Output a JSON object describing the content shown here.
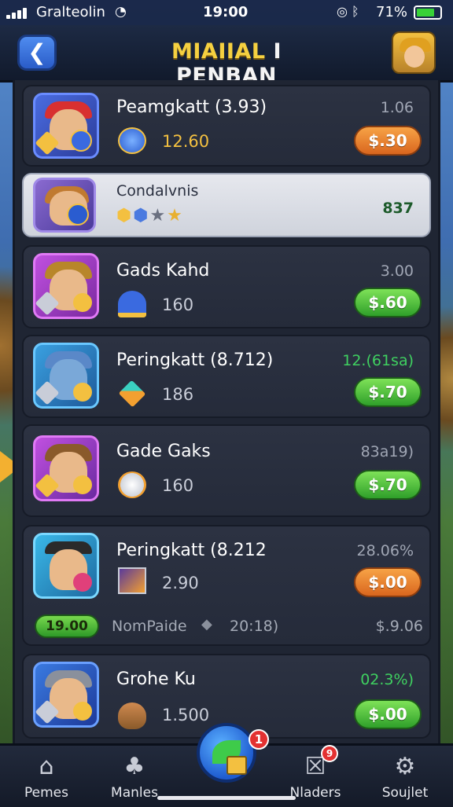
{
  "status_bar": {
    "carrier": "Gralteolin",
    "time": "19:00",
    "battery_pct": "71%",
    "icons": [
      "signal-icon",
      "wifi-icon",
      "alarm-icon",
      "bluetooth-icon",
      "battery-icon"
    ]
  },
  "header": {
    "title_left": "MIAIIAL",
    "title_right": "I PENBAN",
    "back_icon": "back-arrow-icon",
    "avatar_icon": "player-avatar-icon"
  },
  "rows": [
    {
      "name": "Peamgkatt (3.93)",
      "stat": "1.06",
      "count": "12.60",
      "price": "$.30",
      "price_color": "orange"
    },
    {
      "name": "Condalvnis",
      "stat": "837",
      "selected": true
    },
    {
      "name": "Gads Kahd",
      "stat": "3.00",
      "count": "160",
      "price": "$.60",
      "price_color": "green"
    },
    {
      "name": "Peringkatt (8.712)",
      "stat": "12.(61sa)",
      "count": "186",
      "price": "$.70",
      "price_color": "green"
    },
    {
      "name": "Gade Gaks",
      "stat": "83a19)",
      "count": "160",
      "price": "$.70",
      "price_color": "green"
    },
    {
      "name": "Peringkatt (8.212",
      "stat": "28.06%",
      "count": "2.90",
      "price": "$.00",
      "price_color": "orange",
      "sub": {
        "pill": "19.00",
        "text": "NomPaide",
        "num": "20:18)",
        "right": "$.9.06"
      }
    },
    {
      "name": "Grohe Ku",
      "stat": "02.3%)",
      "count": "1.500",
      "price": "$.00",
      "price_color": "green"
    }
  ],
  "tabbar": {
    "tabs": [
      {
        "label": "Pemes",
        "icon": "home-icon"
      },
      {
        "label": "Manles",
        "icon": "puzzle-icon"
      },
      {
        "label": "Nladers",
        "icon": "mail-icon"
      },
      {
        "label": "Soujlet",
        "icon": "gear-icon"
      }
    ],
    "center_badge": "1",
    "nladers_badge": "9"
  },
  "colors": {
    "accent_gold": "#f3c040",
    "price_orange": "#d9661e",
    "price_green": "#2f9f2a",
    "panel": "#1f2533"
  }
}
